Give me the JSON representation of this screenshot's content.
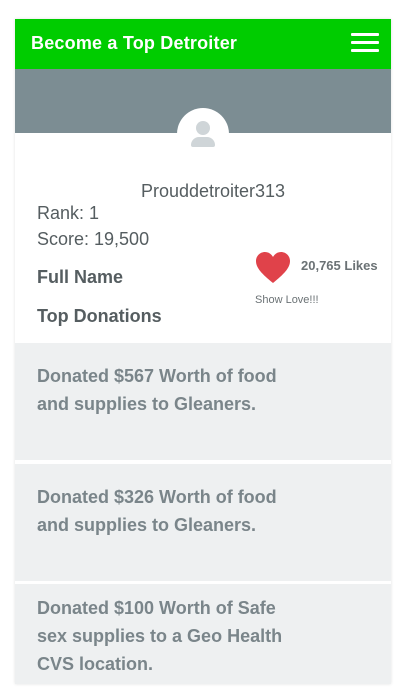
{
  "header": {
    "title": "Become a Top Detroiter",
    "menu_icon": "hamburger-icon"
  },
  "colors": {
    "header_bg": "#00cc00",
    "cover_bg": "#7c8d93",
    "heart": "#e0424a",
    "donation_bg": "#eef0f1"
  },
  "profile": {
    "avatar_icon": "user-icon",
    "username": "Prouddetroiter313",
    "rank": "Rank: 1",
    "score": "Score: 19,500",
    "full_name_label": "Full Name",
    "top_donations_label": "Top Donations",
    "likes_text": "20,765 Likes",
    "show_love": "Show Love!!!"
  },
  "donations": [
    {
      "text": "Donated $567 Worth of food and supplies to Gleaners."
    },
    {
      "text": "Donated $326 Worth of food and supplies to Gleaners."
    },
    {
      "text": "Donated $100 Worth of Safe sex  supplies to a Geo Health CVS location."
    }
  ]
}
